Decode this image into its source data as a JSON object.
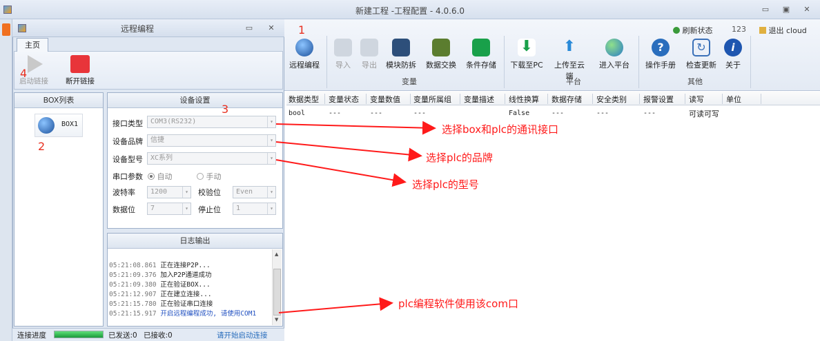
{
  "window": {
    "title": "新建工程 -工程配置 - 4.0.6.0"
  },
  "sub": {
    "title": "远程编程"
  },
  "topright": {
    "refresh": "刷新状态",
    "user": "123",
    "logout": "退出 cloud"
  },
  "ribbon": {
    "buttons": [
      "远程编程",
      "导入",
      "导出",
      "模块防拆",
      "数据交换",
      "条件存储",
      "下载至PC",
      "上传至云端",
      "进入平台",
      "操作手册",
      "检查更新",
      "关于"
    ],
    "groups": [
      "变量",
      "平台",
      "其他"
    ]
  },
  "columns": [
    "数据类型",
    "变量状态",
    "变量数值",
    "变量所属组",
    "变量描述",
    "线性换算",
    "数据存储",
    "安全类别",
    "报警设置",
    "读写",
    "单位"
  ],
  "row": [
    "bool",
    "---",
    "---",
    "---",
    "",
    "False",
    "---",
    "---",
    "---",
    "可读可写",
    ""
  ],
  "subwin": {
    "tab": "主页",
    "start": "启动链接",
    "stop": "断开链接"
  },
  "boxlist": {
    "header": "BOX列表",
    "item": "BOX1"
  },
  "settings": {
    "header": "设备设置",
    "iface_label": "接口类型",
    "iface_value": "COM3(RS232)",
    "brand_label": "设备品牌",
    "brand_value": "信捷",
    "model_label": "设备型号",
    "model_value": "XC系列",
    "serial_label": "串口参数",
    "auto": "自动",
    "manual": "手动",
    "baud_label": "波特率",
    "baud_value": "1200",
    "parity_label": "校验位",
    "parity_value": "Even",
    "databits_label": "数据位",
    "databits_value": "7",
    "stopbits_label": "停止位",
    "stopbits_value": "1"
  },
  "log": {
    "header": "日志输出",
    "lines": [
      {
        "t": "05:21:08.861",
        "m": "正在连接P2P..."
      },
      {
        "t": "05:21:09.376",
        "m": "加入P2P通道成功"
      },
      {
        "t": "05:21:09.380",
        "m": "正在验证BOX..."
      },
      {
        "t": "05:21:12.907",
        "m": "正在建立连接..."
      },
      {
        "t": "05:21:15.780",
        "m": "正在验证串口连接"
      },
      {
        "t": "05:21:15.917",
        "m": "开启远程编程成功, 请使用COM1"
      }
    ]
  },
  "status": {
    "progress_label": "连接进度",
    "progress": 1.0,
    "sent": "已发送:0",
    "recv": "已接收:0",
    "hint": "请开始启动连接"
  },
  "annotations": {
    "n1": "1",
    "n2": "2",
    "n3": "3",
    "n4": "4",
    "a1": "选择box和plc的通讯接口",
    "a2": "选择plc的品牌",
    "a3": "选择plc的型号",
    "a4": "plc编程软件使用该com口"
  },
  "colors": {
    "accent": "#2a6ebd",
    "annotation": "#ff1a1a",
    "progress": "#22b14c"
  }
}
